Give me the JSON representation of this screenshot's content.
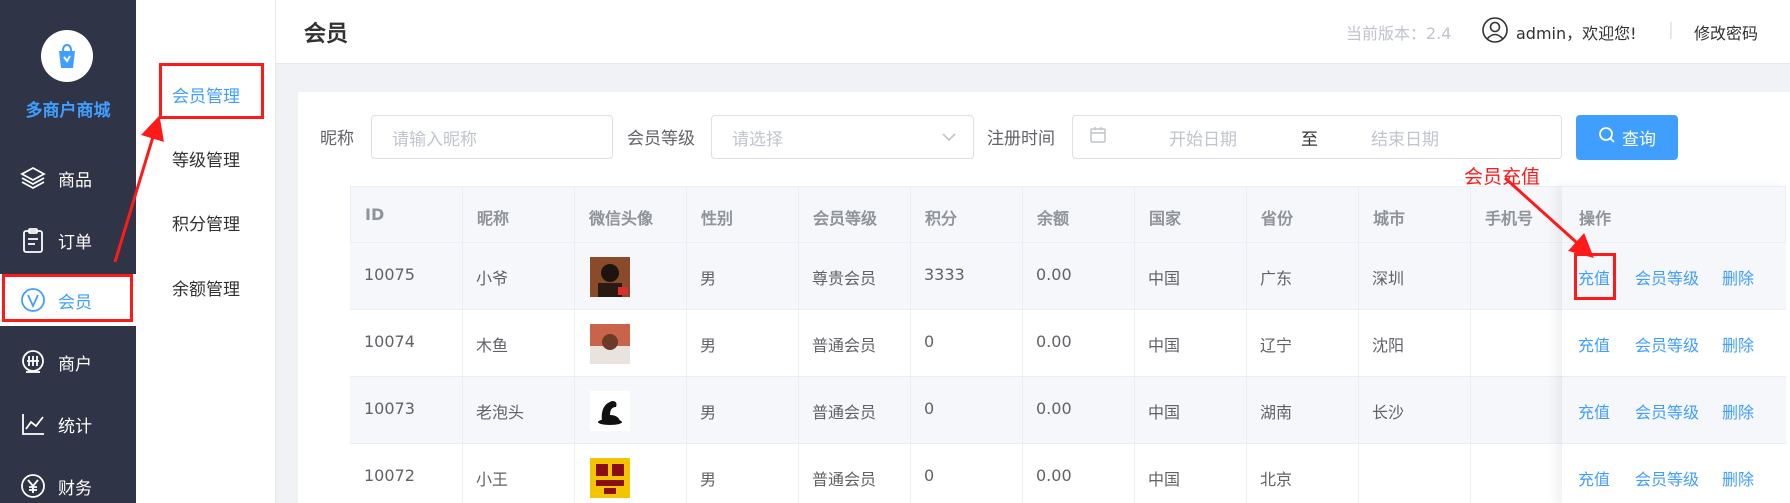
{
  "sidebar": {
    "logo_text": "多商户商城",
    "items": [
      {
        "label": "商品",
        "icon": "layers-icon"
      },
      {
        "label": "订单",
        "icon": "clipboard-icon"
      },
      {
        "label": "会员",
        "icon": "vip-icon"
      },
      {
        "label": "商户",
        "icon": "supplier-icon"
      },
      {
        "label": "统计",
        "icon": "chart-line-icon"
      },
      {
        "label": "财务",
        "icon": "yen-icon"
      }
    ],
    "active_index": 2
  },
  "subnav": {
    "items": [
      {
        "label": "会员管理"
      },
      {
        "label": "等级管理"
      },
      {
        "label": "积分管理"
      },
      {
        "label": "余额管理"
      }
    ],
    "active_index": 0
  },
  "header": {
    "title": "会员",
    "version": "当前版本：2.4",
    "user": "admin，欢迎您!",
    "separator": "|",
    "change_password": "修改密码"
  },
  "filters": {
    "nickname_label": "昵称",
    "nickname_placeholder": "请输入昵称",
    "level_label": "会员等级",
    "level_placeholder": "请选择",
    "regtime_label": "注册时间",
    "start_placeholder": "开始日期",
    "range_sep": "至",
    "end_placeholder": "结束日期",
    "search_label": "查询"
  },
  "table": {
    "columns": [
      "ID",
      "昵称",
      "微信头像",
      "性别",
      "会员等级",
      "积分",
      "余额",
      "国家",
      "省份",
      "城市",
      "手机号",
      "操作"
    ],
    "rows": [
      {
        "id": "10075",
        "nickname": "小爷",
        "gender": "男",
        "level": "尊贵会员",
        "points": "3333",
        "balance": "0.00",
        "country": "中国",
        "province": "广东",
        "city": "深圳",
        "phone": ""
      },
      {
        "id": "10074",
        "nickname": "木鱼",
        "gender": "男",
        "level": "普通会员",
        "points": "0",
        "balance": "0.00",
        "country": "中国",
        "province": "辽宁",
        "city": "沈阳",
        "phone": ""
      },
      {
        "id": "10073",
        "nickname": "老泡头",
        "gender": "男",
        "level": "普通会员",
        "points": "0",
        "balance": "0.00",
        "country": "中国",
        "province": "湖南",
        "city": "长沙",
        "phone": ""
      },
      {
        "id": "10072",
        "nickname": "小王",
        "gender": "男",
        "level": "普通会员",
        "points": "0",
        "balance": "0.00",
        "country": "中国",
        "province": "北京",
        "city": "",
        "phone": ""
      }
    ],
    "actions": {
      "recharge": "充值",
      "level": "会员等级",
      "delete": "删除"
    }
  },
  "annotation": {
    "text": "会员充值",
    "color": "#ff1a1a"
  },
  "colors": {
    "accent": "#409eff",
    "sidebar_bg": "#2f3447"
  }
}
